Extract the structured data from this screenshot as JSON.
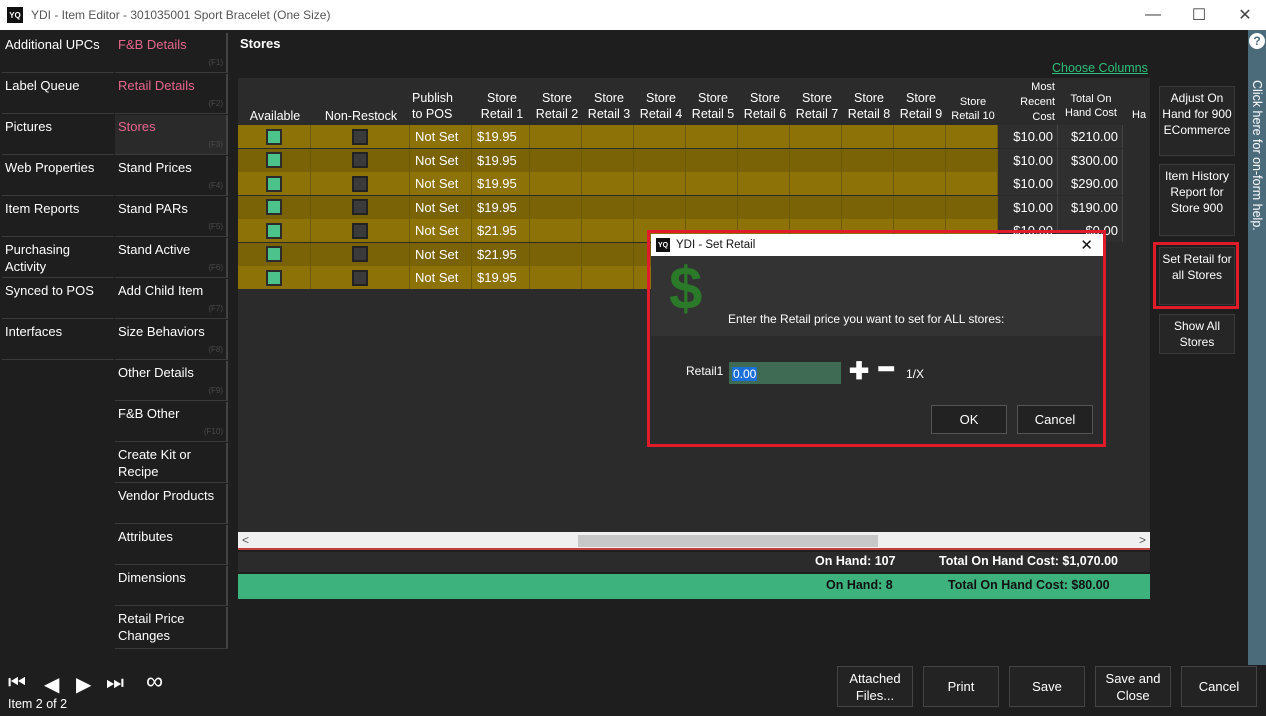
{
  "window": {
    "title": "YDI - Item Editor - 301035001 Sport Bracelet (One Size)",
    "logo": "YQ",
    "minimize": "—",
    "maximize": "☐",
    "close": "✕"
  },
  "nav_left": [
    {
      "label": "Additional UPCs"
    },
    {
      "label": "Label Queue"
    },
    {
      "label": "Pictures"
    },
    {
      "label": "Web Properties"
    },
    {
      "label": "Item Reports"
    },
    {
      "label": "Purchasing Activity"
    },
    {
      "label": "Synced to POS"
    },
    {
      "label": "Interfaces"
    }
  ],
  "nav_right": [
    {
      "label": "F&B Details",
      "key": "(F1)"
    },
    {
      "label": "Retail Details",
      "key": "(F2)"
    },
    {
      "label": "Stores",
      "key": "(F3)"
    },
    {
      "label": "Stand Prices",
      "key": "(F4)"
    },
    {
      "label": "Stand PARs",
      "key": "(F5)"
    },
    {
      "label": "Stand Active",
      "key": "(F6)"
    },
    {
      "label": "Add Child Item",
      "key": "(F7)"
    },
    {
      "label": "Size Behaviors",
      "key": "(F8)"
    },
    {
      "label": "Other Details",
      "key": "(F9)"
    },
    {
      "label": "F&B Other",
      "key": "(F10)"
    },
    {
      "label": "Create Kit or Recipe",
      "key": ""
    },
    {
      "label": "Vendor Products",
      "key": ""
    },
    {
      "label": "Attributes",
      "key": ""
    },
    {
      "label": "Dimensions",
      "key": ""
    },
    {
      "label": "Retail Price Changes",
      "key": ""
    }
  ],
  "main": {
    "title": "Stores",
    "choose_columns": "Choose Columns"
  },
  "columns": {
    "available": "Available",
    "non_restock": "Non-Restock",
    "publish": "Publish to POS",
    "retail1": "Store Retail 1",
    "retail2": "Store Retail 2",
    "retail3": "Store Retail 3",
    "retail4": "Store Retail 4",
    "retail5": "Store Retail 5",
    "retail6": "Store Retail 6",
    "retail7": "Store Retail 7",
    "retail8": "Store Retail 8",
    "retail9": "Store Retail 9",
    "retail10": "Store Retail 10",
    "recent_cost": "Most Recent Cost",
    "total_cost": "Total On Hand Cost",
    "cut": "Ha"
  },
  "rows": [
    {
      "publish": "Not Set",
      "retail1": "$19.95",
      "cost": "$10.00",
      "total": "$210.00"
    },
    {
      "publish": "Not Set",
      "retail1": "$19.95",
      "cost": "$10.00",
      "total": "$300.00"
    },
    {
      "publish": "Not Set",
      "retail1": "$19.95",
      "cost": "$10.00",
      "total": "$290.00"
    },
    {
      "publish": "Not Set",
      "retail1": "$19.95",
      "cost": "$10.00",
      "total": "$190.00"
    },
    {
      "publish": "Not Set",
      "retail1": "$21.95",
      "cost": "$10.00",
      "total": "$0.00"
    },
    {
      "publish": "Not Set",
      "retail1": "$21.95",
      "cost": "",
      "total": "00"
    },
    {
      "publish": "Not Set",
      "retail1": "$19.95",
      "cost": "",
      "total": "00"
    }
  ],
  "totals": {
    "on_hand_all": "On Hand: 107",
    "cost_all": "Total On Hand Cost: $1,070.00",
    "on_hand_sel": "On Hand: 8",
    "cost_sel": "Total On Hand Cost: $80.00"
  },
  "right_buttons": {
    "adjust": "Adjust On Hand for 900 ECommerce",
    "history": "Item History Report for Store 900",
    "set_retail": "Set Retail for all Stores",
    "show_all": "Show All Stores"
  },
  "help": {
    "q": "?",
    "text": "Click here for on-form help."
  },
  "bottom": {
    "item_of": "Item 2 of 2",
    "first": "⏮",
    "prev": "◀",
    "next": "▶",
    "last": "⏭",
    "infinity": "∞",
    "attached": "Attached Files...",
    "print": "Print",
    "save": "Save",
    "save_close": "Save and Close",
    "cancel": "Cancel"
  },
  "dialog": {
    "logo": "YQ",
    "title": "YDI - Set Retail",
    "close": "✕",
    "icon": "$",
    "prompt": "Enter the Retail price you want to set for ALL stores:",
    "retail_label": "Retail1",
    "retail_value": "0.00",
    "plus": "✚",
    "minus": "━",
    "onex": "1/X",
    "ok": "OK",
    "cancel": "Cancel"
  },
  "colors": {
    "gold": "#8c7207",
    "gold_dark": "#7a6306",
    "accent_green": "#3db27d",
    "pink": "#e8668c",
    "highlight_red": "#e21b2a"
  }
}
